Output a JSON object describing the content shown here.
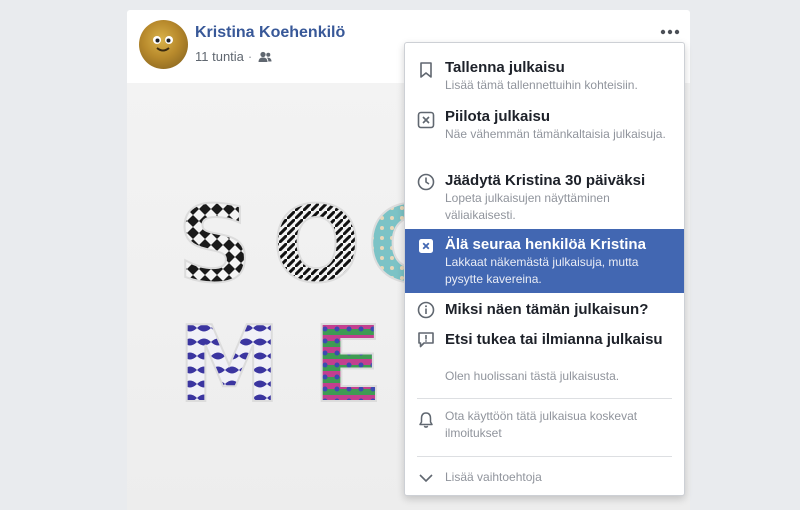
{
  "post": {
    "author": "Kristina Koehenkilö",
    "time": "11 tuntia",
    "separator": "·",
    "audience_icon": "friends-icon",
    "more_icon": "more-dots-icon"
  },
  "photo": {
    "letters": [
      "S",
      "O",
      "C",
      "M",
      "E"
    ]
  },
  "menu": {
    "items": [
      {
        "icon": "bookmark-icon",
        "title": "Tallenna julkaisu",
        "desc": "Lisää tämä tallennettuihin kohteisiin."
      },
      {
        "icon": "hide-x-icon",
        "title": "Piilota julkaisu",
        "desc": "Näe vähemmän tämänkaltaisia julkaisuja."
      },
      {
        "icon": "clock-icon",
        "title": "Jäädytä Kristina 30 päiväksi",
        "desc": "Lopeta julkaisujen näyttäminen väliaikaisesti."
      },
      {
        "icon": "unfollow-icon",
        "title": "Älä seuraa henkilöä Kristina",
        "desc": "Lakkaat näkemästä julkaisuja, mutta pysytte kavereina."
      },
      {
        "icon": "info-icon",
        "title": "Miksi näen tämän julkaisun?"
      },
      {
        "icon": "report-icon",
        "title": "Etsi tukea tai ilmianna julkaisu",
        "desc": "Olen huolissani tästä julkaisusta."
      }
    ],
    "notifications": {
      "icon": "bell-icon",
      "label": "Ota käyttöön tätä julkaisua koskevat ilmoitukset"
    },
    "more": {
      "icon": "chevron-down-icon",
      "label": "Lisää vaihtoehtoja"
    },
    "highlight_color": "#4267b2"
  }
}
